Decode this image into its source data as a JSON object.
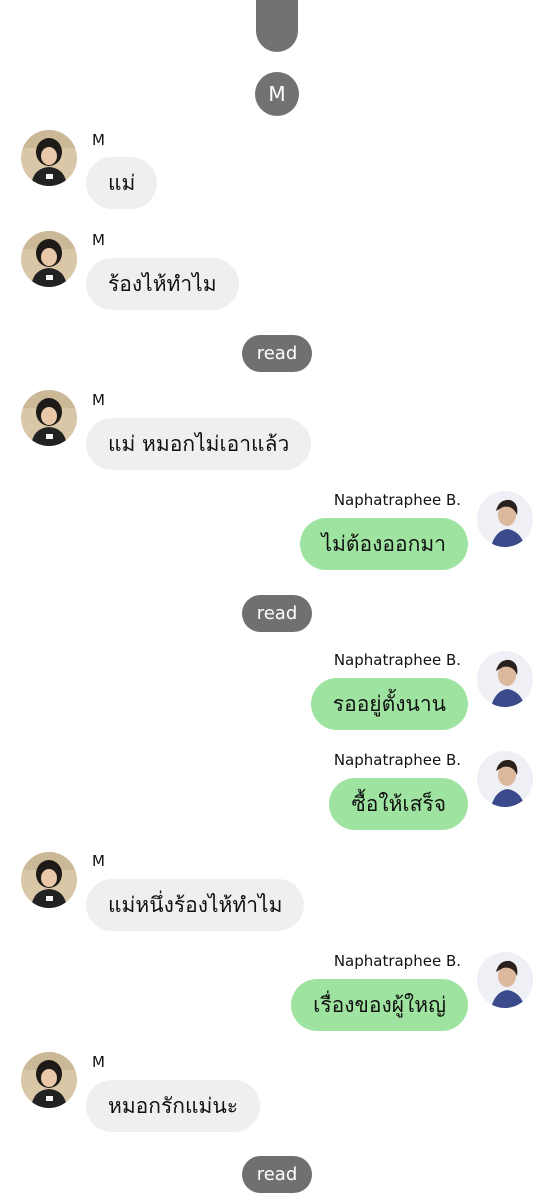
{
  "top_badge": "M",
  "read_label": "read",
  "messages": [
    {
      "sender": "M",
      "text": "แม่"
    },
    {
      "sender": "M",
      "text": "ร้องไห้ทำไม"
    },
    {
      "sender": "M",
      "text": "แม่ หมอกไม่เอาแล้ว"
    },
    {
      "sender": "Naphatraphee B.",
      "text": "ไม่ต้องออกมา"
    },
    {
      "sender": "Naphatraphee B.",
      "text": "รออยู่ตั้งนาน"
    },
    {
      "sender": "Naphatraphee B.",
      "text": "ซื้อให้เสร็จ"
    },
    {
      "sender": "M",
      "text": "แม่หนึ่งร้องไห้ทำไม"
    },
    {
      "sender": "Naphatraphee B.",
      "text": "เรื่องของผู้ใหญ่"
    },
    {
      "sender": "M",
      "text": "หมอกรักแม่นะ"
    }
  ],
  "colors": {
    "incoming_bubble": "#efefef",
    "outgoing_bubble": "#9fe3a0",
    "badge": "#707070"
  }
}
